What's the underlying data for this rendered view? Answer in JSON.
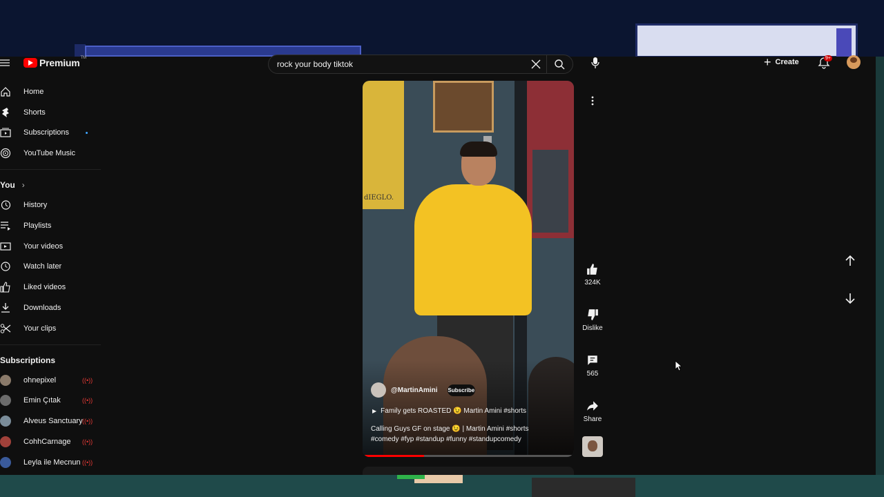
{
  "header": {
    "logo_text": "Premium",
    "search_value": "rock your body tiktok",
    "create_label": "Create",
    "notification_badge": "9+"
  },
  "sidebar": {
    "main_items": [
      {
        "label": "Home",
        "icon": "home-icon"
      },
      {
        "label": "Shorts",
        "icon": "shorts-icon"
      },
      {
        "label": "Subscriptions",
        "icon": "subscriptions-icon"
      },
      {
        "label": "YouTube Music",
        "icon": "music-icon"
      }
    ],
    "you_title": "You",
    "you_items": [
      {
        "label": "History",
        "icon": "history-icon"
      },
      {
        "label": "Playlists",
        "icon": "playlists-icon"
      },
      {
        "label": "Your videos",
        "icon": "your-videos-icon"
      },
      {
        "label": "Watch later",
        "icon": "clock-icon"
      },
      {
        "label": "Liked videos",
        "icon": "like-icon"
      },
      {
        "label": "Downloads",
        "icon": "download-icon"
      },
      {
        "label": "Your clips",
        "icon": "scissors-icon"
      }
    ],
    "subscriptions_title": "Subscriptions",
    "subscriptions": [
      {
        "label": "ohnepixel",
        "color": "#8a7a6a"
      },
      {
        "label": "Emin Çıtak",
        "color": "#6b6b6b"
      },
      {
        "label": "Alveus Sanctuary",
        "color": "#7a8c99"
      },
      {
        "label": "CohhCarnage",
        "color": "#a0413a"
      },
      {
        "label": "Leyla ile Mecnun",
        "color": "#3a5a9a"
      }
    ]
  },
  "short": {
    "channel": "@MartinAmini",
    "subscribe_label": "Subscribe",
    "playlist_title": "Family gets ROASTED 😉 Martin Amini #shorts",
    "description": "Calling Guys GF on stage 😉 | Martin Amini #shorts #comedy #fyp #standup #funny #standupcomedy",
    "progress": 0.29,
    "wall_text": "dIEGLO."
  },
  "actions": {
    "likes": "324K",
    "dislike": "Dislike",
    "comments": "565",
    "share": "Share"
  }
}
